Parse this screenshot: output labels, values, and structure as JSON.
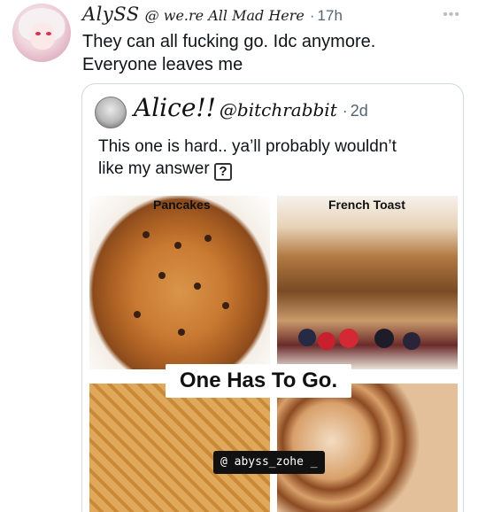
{
  "tweet": {
    "display_name": "AlySS",
    "handle": "@ we.re All Mad Here",
    "separator": "·",
    "timestamp": "17h",
    "more_icon": "more-horizontal-icon",
    "text_line1": "They can all fucking go. Idc anymore.",
    "text_line2": "Everyone leaves me"
  },
  "quoted_tweet": {
    "display_name": "Alice!!",
    "handle": "@bitchrabbit",
    "separator": "·",
    "timestamp": "2d",
    "text_line1": "This one is hard.. ya’ll probably wouldn’t",
    "text_line2": "like my answer",
    "question_glyph": "?"
  },
  "media": {
    "label_top_left": "Pancakes",
    "label_top_right": "French Toast",
    "banner": "One Has To Go.",
    "watermark": "@ abyss_zohe _"
  },
  "colors": {
    "text_primary": "#0f1419",
    "text_secondary": "#536471",
    "card_border": "#cfd9de"
  }
}
